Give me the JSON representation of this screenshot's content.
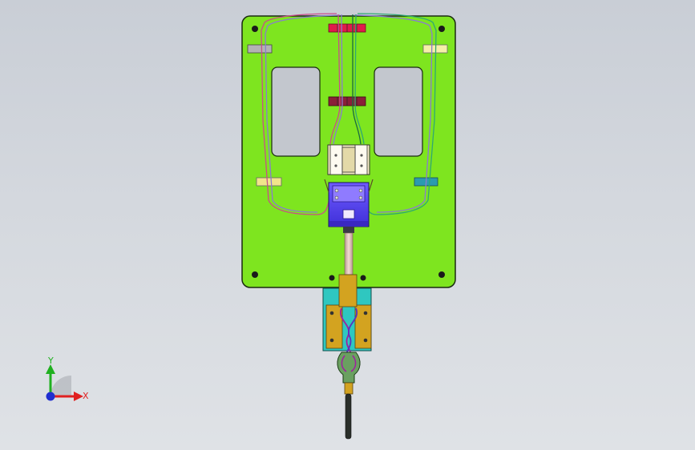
{
  "viewport": {
    "kind": "cad-model-view",
    "background_top": "#c9ced6",
    "background_bottom": "#dfe2e6"
  },
  "model": {
    "base_plate_color": "#7ee51f",
    "base_plate_outline": "#1a2a10",
    "window_color": "#c3c7ce",
    "slide_block_color": "#6f4cff",
    "carriage_color": "#f5ecc4",
    "lower_bracket_color": "#d3a320",
    "lower_mount_color": "#2fc7c0",
    "rod_color": "#e8c7b8",
    "cable_colors": [
      "#c94e8a",
      "#8a7bd0",
      "#2fa872"
    ],
    "clip_colors": [
      "#b3b3b3",
      "#f5f0a8",
      "#f1e58a",
      "#2b9bb0",
      "#e01b4a",
      "#8a2038"
    ]
  },
  "triad": {
    "x_label": "X",
    "y_label": "Y",
    "x_color": "#e02020",
    "y_color": "#20b020",
    "origin_color": "#1f2fd0"
  }
}
